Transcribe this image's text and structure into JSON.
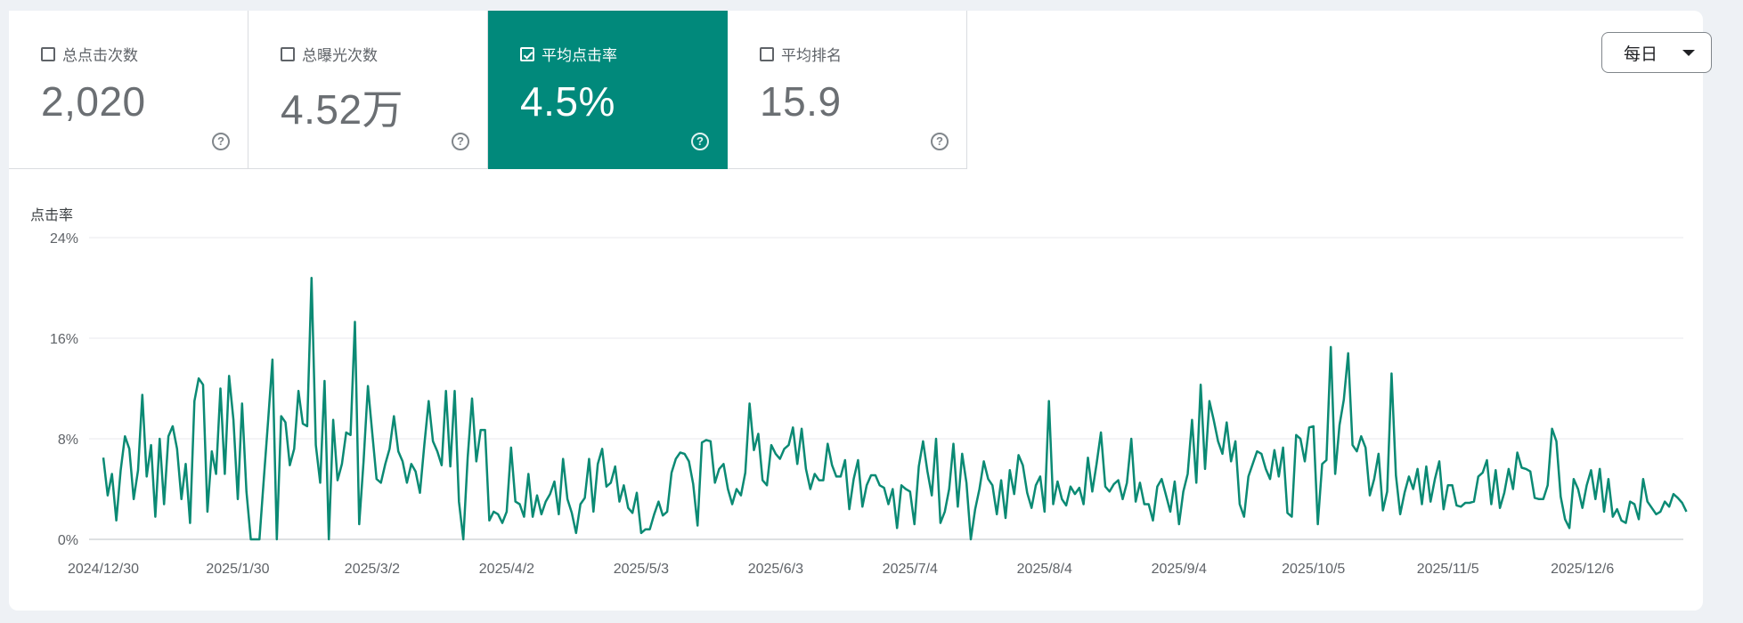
{
  "metrics": [
    {
      "label": "总点击次数",
      "value": "2,020",
      "checked": false
    },
    {
      "label": "总曝光次数",
      "value": "4.52万",
      "checked": false
    },
    {
      "label": "平均点击率",
      "value": "4.5%",
      "checked": true
    },
    {
      "label": "平均排名",
      "value": "15.9",
      "checked": false
    }
  ],
  "help_glyph": "?",
  "granularity": {
    "selected": "每日"
  },
  "colors": {
    "accent": "#01897b",
    "line": "#0b8a74"
  },
  "chart_data": {
    "type": "line",
    "ylabel": "点击率",
    "ylim": [
      0,
      24
    ],
    "yticks": [
      0,
      8,
      16,
      24
    ],
    "ytick_labels": [
      "0%",
      "8%",
      "16%",
      "24%"
    ],
    "x_start": "2024-12-30",
    "xtick_labels": [
      "2024/12/30",
      "2025/1/30",
      "2025/3/2",
      "2025/4/2",
      "2025/5/3",
      "2025/6/3",
      "2025/7/4",
      "2025/8/4",
      "2025/9/4",
      "2025/10/5",
      "2025/11/5",
      "2025/12/6"
    ],
    "series": [
      {
        "values": [
          6.5,
          3.5,
          5.2,
          1.5,
          5.5,
          8.2,
          7.2,
          3.2,
          5.5,
          11.5,
          5.0,
          7.5,
          1.8,
          8.0,
          2.8,
          8.2,
          9.0,
          7.2,
          3.2,
          6.0,
          1.3,
          11.0,
          12.8,
          12.3,
          2.2,
          7.0,
          5.2,
          12.0,
          5.2,
          13.0,
          9.5,
          3.2,
          10.8,
          3.8,
          0.0,
          0.0,
          0.0,
          4.8,
          9.5,
          14.3,
          0.0,
          9.8,
          9.3,
          5.9,
          7.2,
          11.8,
          9.2,
          9.0,
          20.8,
          7.5,
          4.5,
          12.6,
          0.0,
          9.5,
          4.7,
          6.0,
          8.5,
          8.3,
          17.3,
          1.2,
          6.2,
          12.2,
          8.5,
          4.8,
          4.5,
          6.0,
          7.2,
          9.8,
          7.0,
          6.2,
          4.5,
          6.0,
          5.4,
          3.7,
          7.5,
          11.0,
          7.8,
          7.0,
          5.9,
          11.8,
          5.8,
          11.8,
          3.0,
          0.0,
          6.5,
          11.2,
          6.2,
          8.7,
          8.7,
          1.5,
          2.2,
          2.0,
          1.3,
          2.2,
          7.3,
          3.0,
          2.8,
          1.8,
          5.2,
          1.8,
          3.5,
          2.0,
          3.0,
          3.6,
          4.6,
          2.0,
          6.4,
          3.2,
          2.1,
          0.5,
          2.8,
          3.3,
          6.4,
          2.2,
          6.0,
          7.2,
          4.2,
          4.5,
          5.8,
          3.0,
          4.3,
          2.5,
          2.1,
          3.7,
          0.5,
          0.8,
          0.8,
          2.0,
          3.0,
          1.9,
          2.2,
          5.3,
          6.4,
          6.9,
          6.8,
          6.2,
          4.4,
          1.1,
          7.7,
          7.9,
          7.8,
          4.5,
          5.6,
          6.0,
          4.0,
          2.8,
          4.0,
          3.5,
          5.3,
          10.8,
          7.1,
          8.4,
          4.7,
          4.3,
          7.5,
          6.8,
          6.4,
          7.2,
          7.5,
          8.9,
          6.0,
          8.8,
          5.6,
          4.0,
          5.2,
          4.7,
          4.7,
          7.6,
          5.9,
          5.0,
          5.0,
          6.3,
          2.4,
          4.8,
          6.3,
          2.6,
          4.3,
          5.1,
          5.1,
          4.3,
          4.1,
          2.8,
          4.0,
          0.9,
          4.3,
          4.0,
          3.8,
          1.2,
          5.8,
          7.8,
          5.4,
          3.5,
          8.0,
          1.3,
          2.2,
          4.0,
          7.6,
          2.6,
          6.8,
          4.5,
          0.0,
          2.4,
          4.0,
          6.2,
          4.8,
          4.3,
          2.0,
          4.7,
          1.7,
          5.5,
          3.6,
          6.7,
          5.9,
          3.7,
          2.5,
          4.3,
          5.0,
          2.2,
          11.0,
          2.8,
          4.6,
          3.2,
          2.7,
          4.2,
          3.6,
          4.1,
          2.8,
          6.5,
          3.8,
          6.0,
          8.5,
          4.2,
          3.8,
          4.4,
          4.7,
          3.2,
          4.5,
          8.0,
          3.0,
          4.5,
          2.8,
          2.8,
          1.5,
          4.2,
          4.8,
          3.5,
          2.2,
          4.6,
          1.2,
          3.8,
          5.2,
          9.5,
          4.5,
          12.3,
          5.6,
          11.0,
          9.5,
          7.8,
          6.8,
          9.3,
          6.2,
          7.8,
          2.8,
          1.8,
          5.0,
          6.0,
          7.0,
          6.8,
          5.6,
          4.8,
          7.1,
          5.0,
          7.3,
          2.1,
          1.8,
          8.3,
          8.0,
          6.2,
          8.9,
          9.0,
          1.2,
          6.0,
          6.3,
          15.3,
          5.2,
          9.1,
          11.1,
          14.8,
          7.5,
          7.0,
          8.2,
          7.3,
          3.5,
          4.8,
          6.8,
          2.3,
          3.8,
          13.2,
          5.1,
          2.0,
          3.7,
          5.0,
          4.0,
          5.6,
          2.8,
          5.8,
          3.0,
          4.8,
          6.2,
          2.4,
          4.3,
          4.3,
          2.7,
          2.6,
          2.9,
          2.9,
          3.0,
          5.0,
          5.3,
          6.3,
          2.8,
          5.5,
          2.5,
          3.7,
          5.6,
          4.0,
          6.9,
          5.7,
          5.6,
          5.4,
          3.3,
          3.2,
          3.2,
          4.3,
          8.8,
          7.8,
          3.4,
          1.6,
          0.9,
          4.8,
          4.0,
          2.5,
          4.3,
          5.5,
          3.2,
          5.6,
          2.2,
          4.8,
          1.8,
          2.4,
          1.5,
          1.3,
          3.0,
          2.8,
          1.6,
          4.8,
          3.0,
          2.5,
          2.0,
          2.2,
          3.0,
          2.6,
          3.6,
          3.3,
          2.9,
          2.2
        ]
      }
    ]
  }
}
